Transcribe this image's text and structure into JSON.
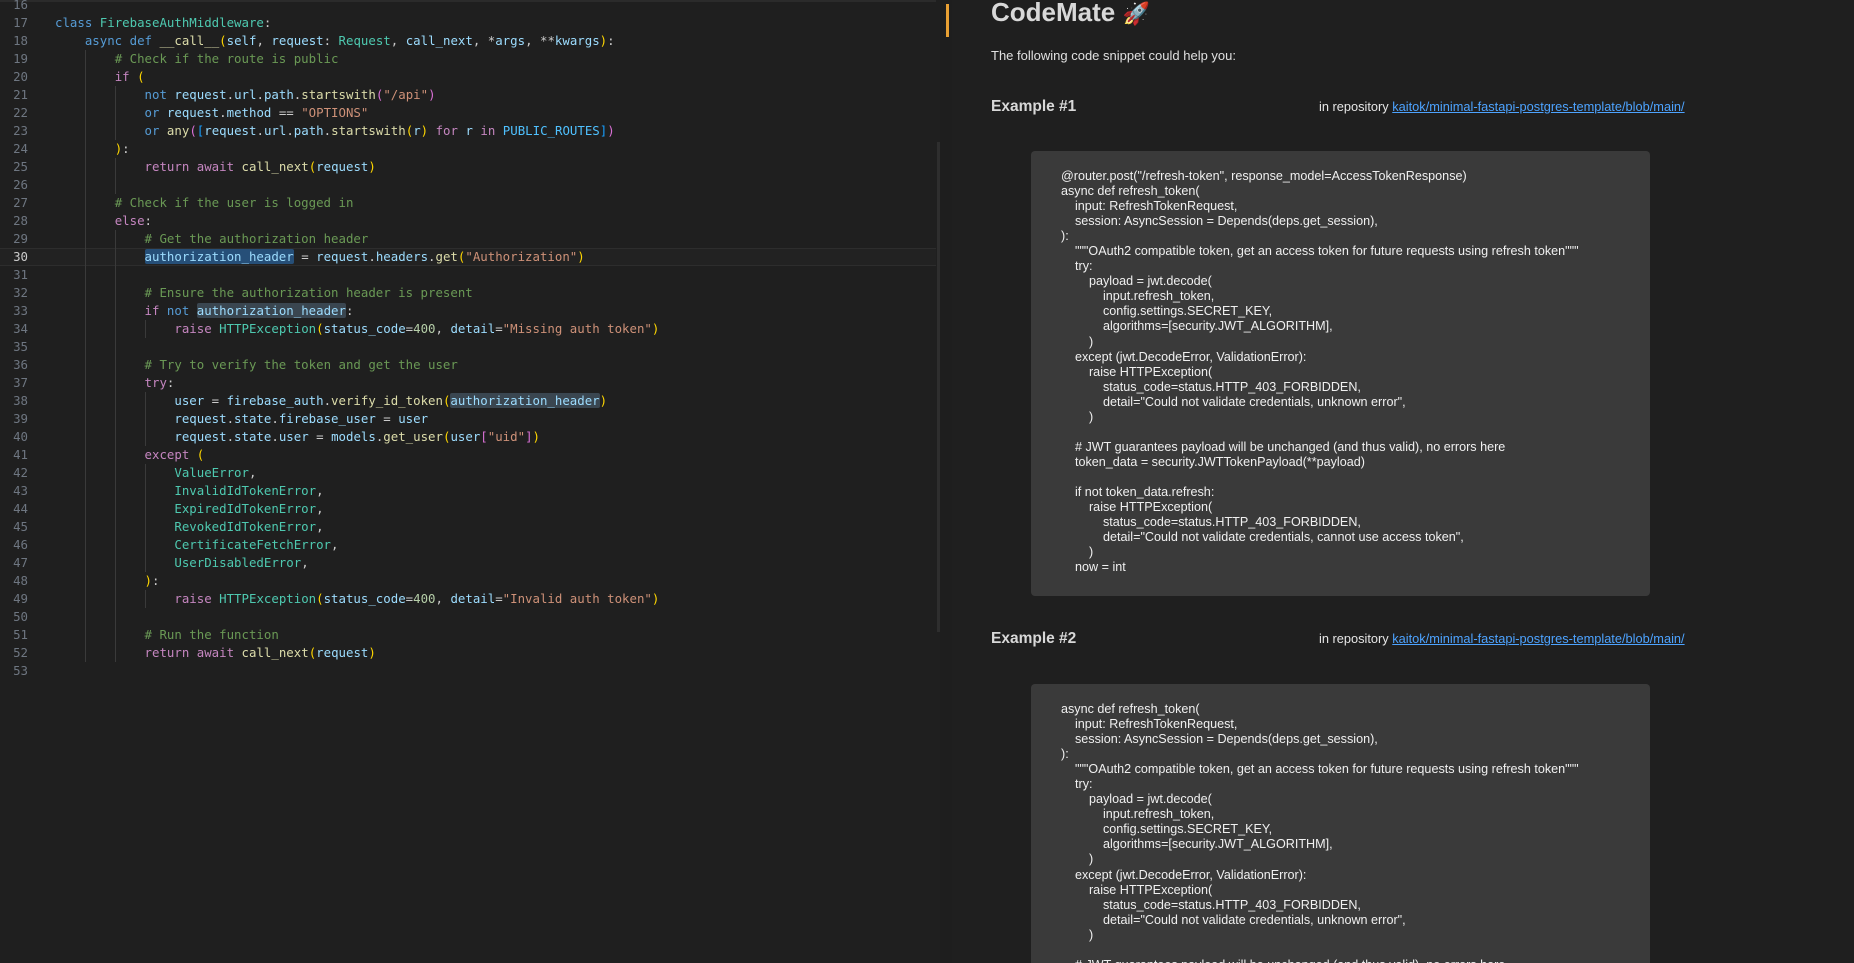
{
  "editor": {
    "current_line": 30,
    "lines": [
      {
        "n": 16,
        "html": ""
      },
      {
        "n": 17,
        "html": "<span class='kw'>class</span> <span class='cls'>FirebaseAuthMiddleware</span>:"
      },
      {
        "n": 18,
        "html": "    <span class='kw'>async</span> <span class='kw'>def</span> <span class='fn'>__call__</span><span class='b1'>(</span><span class='var'>self</span>, <span class='var'>request</span>: <span class='cls'>Request</span>, <span class='var'>call_next</span>, *<span class='var'>args</span>, **<span class='var'>kwargs</span><span class='b1'>)</span>:"
      },
      {
        "n": 19,
        "html": "        <span class='cmt'># Check if the route is public</span>"
      },
      {
        "n": 20,
        "html": "        <span class='ctl'>if</span> <span class='b1'>(</span>"
      },
      {
        "n": 21,
        "html": "            <span class='kw'>not</span> <span class='var'>request</span>.<span class='var'>url</span>.<span class='var'>path</span>.<span class='fn'>startswith</span><span class='b2'>(</span><span class='str'>\"/api\"</span><span class='b2'>)</span>"
      },
      {
        "n": 22,
        "html": "            <span class='kw'>or</span> <span class='var'>request</span>.<span class='var'>method</span> == <span class='str'>\"OPTIONS\"</span>"
      },
      {
        "n": 23,
        "html": "            <span class='kw'>or</span> <span class='fn'>any</span><span class='b2'>(</span><span class='b3'>[</span><span class='var'>request</span>.<span class='var'>url</span>.<span class='var'>path</span>.<span class='fn'>startswith</span><span class='b1'>(</span><span class='var'>r</span><span class='b1'>)</span> <span class='ctl'>for</span> <span class='var'>r</span> <span class='ctl'>in</span> <span class='const'>PUBLIC_ROUTES</span><span class='b3'>]</span><span class='b2'>)</span>"
      },
      {
        "n": 24,
        "html": "        <span class='b1'>)</span>:"
      },
      {
        "n": 25,
        "html": "            <span class='ctl'>return</span> <span class='ctl'>await</span> <span class='fn'>call_next</span><span class='b1'>(</span><span class='var'>request</span><span class='b1'>)</span>"
      },
      {
        "n": 26,
        "html": ""
      },
      {
        "n": 27,
        "html": "        <span class='cmt'># Check if the user is logged in</span>"
      },
      {
        "n": 28,
        "html": "        <span class='ctl'>else</span>:"
      },
      {
        "n": 29,
        "html": "            <span class='cmt'># Get the authorization header</span>"
      },
      {
        "n": 30,
        "html": "            <span class='var hl'>authorization_header</span> = <span class='var'>request</span>.<span class='var'>headers</span>.<span class='fn'>get</span><span class='b1'>(</span><span class='str'>\"Authorization\"</span><span class='b1'>)</span>"
      },
      {
        "n": 31,
        "html": ""
      },
      {
        "n": 32,
        "html": "            <span class='cmt'># Ensure the authorization header is present</span>"
      },
      {
        "n": 33,
        "html": "            <span class='ctl'>if</span> <span class='kw'>not</span> <span class='var hl2'>authorization_header</span>:"
      },
      {
        "n": 34,
        "html": "                <span class='ctl'>raise</span> <span class='cls'>HTTPException</span><span class='b1'>(</span><span class='var'>status_code</span>=<span class='num'>400</span>, <span class='var'>detail</span>=<span class='str'>\"Missing auth token\"</span><span class='b1'>)</span>"
      },
      {
        "n": 35,
        "html": ""
      },
      {
        "n": 36,
        "html": "            <span class='cmt'># Try to verify the token and get the user</span>"
      },
      {
        "n": 37,
        "html": "            <span class='ctl'>try</span>:"
      },
      {
        "n": 38,
        "html": "                <span class='var'>user</span> = <span class='var'>firebase_auth</span>.<span class='fn'>verify_id_token</span><span class='b1'>(</span><span class='var hl2'>authorization_header</span><span class='b1'>)</span>"
      },
      {
        "n": 39,
        "html": "                <span class='var'>request</span>.<span class='var'>state</span>.<span class='var'>firebase_user</span> = <span class='var'>user</span>"
      },
      {
        "n": 40,
        "html": "                <span class='var'>request</span>.<span class='var'>state</span>.<span class='var'>user</span> = <span class='var'>models</span>.<span class='fn'>get_user</span><span class='b1'>(</span><span class='var'>user</span><span class='b2'>[</span><span class='str'>\"uid\"</span><span class='b2'>]</span><span class='b1'>)</span>"
      },
      {
        "n": 41,
        "html": "            <span class='ctl'>except</span> <span class='b1'>(</span>"
      },
      {
        "n": 42,
        "html": "                <span class='cls'>ValueError</span>,"
      },
      {
        "n": 43,
        "html": "                <span class='cls'>InvalidIdTokenError</span>,"
      },
      {
        "n": 44,
        "html": "                <span class='cls'>ExpiredIdTokenError</span>,"
      },
      {
        "n": 45,
        "html": "                <span class='cls'>RevokedIdTokenError</span>,"
      },
      {
        "n": 46,
        "html": "                <span class='cls'>CertificateFetchError</span>,"
      },
      {
        "n": 47,
        "html": "                <span class='cls'>UserDisabledError</span>,"
      },
      {
        "n": 48,
        "html": "            <span class='b1'>)</span>:"
      },
      {
        "n": 49,
        "html": "                <span class='ctl'>raise</span> <span class='cls'>HTTPException</span><span class='b1'>(</span><span class='var'>status_code</span>=<span class='num'>400</span>, <span class='var'>detail</span>=<span class='str'>\"Invalid auth token\"</span><span class='b1'>)</span>"
      },
      {
        "n": 50,
        "html": ""
      },
      {
        "n": 51,
        "html": "            <span class='cmt'># Run the function</span>"
      },
      {
        "n": 52,
        "html": "            <span class='ctl'>return</span> <span class='ctl'>await</span> <span class='fn'>call_next</span><span class='b1'>(</span><span class='var'>request</span><span class='b1'>)</span>"
      },
      {
        "n": 53,
        "html": ""
      }
    ]
  },
  "panel": {
    "title": "CodeMate",
    "title_emoji": "🚀",
    "subtitle": "The following code snippet could help you:",
    "examples": [
      {
        "heading": "Example #1",
        "repo_prefix": "in repository",
        "repo_link": "kaitok/minimal-fastapi-postgres-template/blob/main/",
        "code": "@router.post(\"/refresh-token\", response_model=AccessTokenResponse)\nasync def refresh_token(\n    input: RefreshTokenRequest,\n    session: AsyncSession = Depends(deps.get_session),\n):\n    \"\"\"OAuth2 compatible token, get an access token for future requests using refresh token\"\"\"\n    try:\n        payload = jwt.decode(\n            input.refresh_token,\n            config.settings.SECRET_KEY,\n            algorithms=[security.JWT_ALGORITHM],\n        )\n    except (jwt.DecodeError, ValidationError):\n        raise HTTPException(\n            status_code=status.HTTP_403_FORBIDDEN,\n            detail=\"Could not validate credentials, unknown error\",\n        )\n\n    # JWT guarantees payload will be unchanged (and thus valid), no errors here\n    token_data = security.JWTTokenPayload(**payload)\n\n    if not token_data.refresh:\n        raise HTTPException(\n            status_code=status.HTTP_403_FORBIDDEN,\n            detail=\"Could not validate credentials, cannot use access token\",\n        )\n    now = int"
      },
      {
        "heading": "Example #2",
        "repo_prefix": "in repository",
        "repo_link": "kaitok/minimal-fastapi-postgres-template/blob/main/",
        "code": "async def refresh_token(\n    input: RefreshTokenRequest,\n    session: AsyncSession = Depends(deps.get_session),\n):\n    \"\"\"OAuth2 compatible token, get an access token for future requests using refresh token\"\"\"\n    try:\n        payload = jwt.decode(\n            input.refresh_token,\n            config.settings.SECRET_KEY,\n            algorithms=[security.JWT_ALGORITHM],\n        )\n    except (jwt.DecodeError, ValidationError):\n        raise HTTPException(\n            status_code=status.HTTP_403_FORBIDDEN,\n            detail=\"Could not validate credentials, unknown error\",\n        )\n\n    # JWT guarantees payload will be unchanged (and thus valid), no errors here"
      }
    ]
  },
  "colors": {
    "editor_bg": "#1f1f1f",
    "snippet_bg": "#3a3a3a",
    "link": "#4da3ff",
    "accent": "#e8a033"
  }
}
